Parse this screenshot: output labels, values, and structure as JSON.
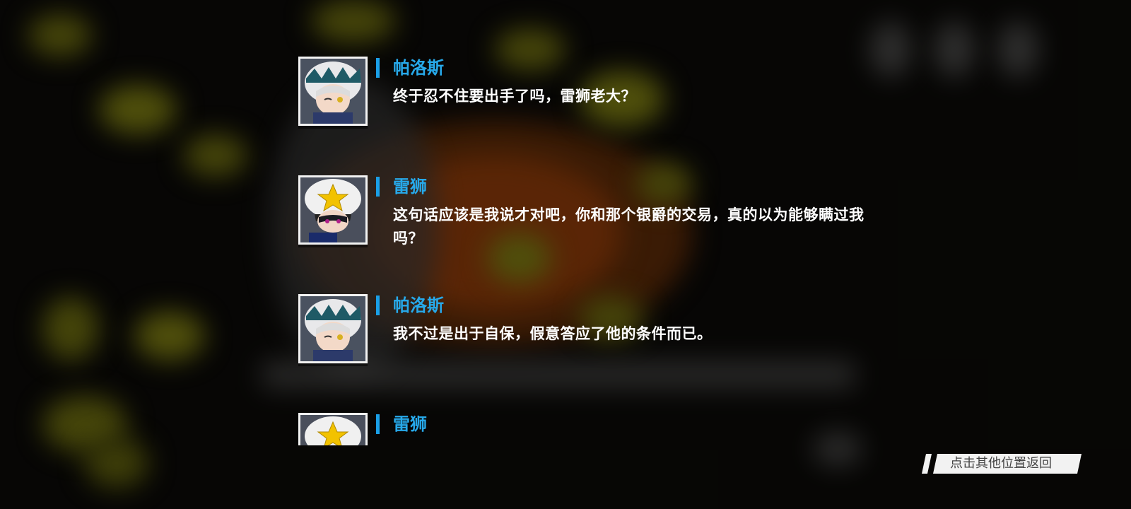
{
  "dialogue_log": [
    {
      "speaker": "帕洛斯",
      "avatar": "palos-portrait-icon",
      "text": "终于忍不住要出手了吗，雷狮老大？"
    },
    {
      "speaker": "雷狮",
      "avatar": "leishi-portrait-icon",
      "text": "这句话应该是我说才对吧，你和那个银爵的交易，真的以为能够瞒过我吗？"
    },
    {
      "speaker": "帕洛斯",
      "avatar": "palos-portrait-icon",
      "text": "我不过是出于自保，假意答应了他的条件而已。"
    },
    {
      "speaker": "雷狮",
      "avatar": "leishi-portrait-icon",
      "text": ""
    }
  ],
  "return_hint": "点击其他位置返回",
  "colors": {
    "speaker": "#27a9ea",
    "accent_bar": "#1aa0e8",
    "text": "#ffffff"
  }
}
